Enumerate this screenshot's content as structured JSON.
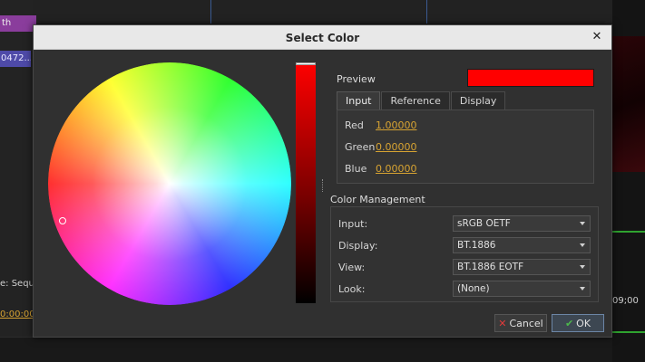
{
  "dialog": {
    "title": "Select Color",
    "close_icon": "close-icon"
  },
  "preview": {
    "label": "Preview",
    "color": "#ff0000"
  },
  "tabs": [
    {
      "label": "Input",
      "active": true
    },
    {
      "label": "Reference",
      "active": false
    },
    {
      "label": "Display",
      "active": false
    }
  ],
  "channels": [
    {
      "label": "Red",
      "value": "1.00000"
    },
    {
      "label": "Green",
      "value": "0.00000"
    },
    {
      "label": "Blue",
      "value": "0.00000"
    }
  ],
  "color_management": {
    "title": "Color Management",
    "rows": [
      {
        "label": "Input:",
        "value": "sRGB OETF"
      },
      {
        "label": "Display:",
        "value": "BT.1886"
      },
      {
        "label": "View:",
        "value": "BT.1886 EOTF"
      },
      {
        "label": "Look:",
        "value": "(None)"
      }
    ]
  },
  "buttons": {
    "cancel": "Cancel",
    "ok": "OK"
  },
  "background": {
    "tag_label": "th",
    "clip_label": "0472....",
    "sequence_label": "e: Seque",
    "timecode_left": "0:00:00;0",
    "timecode_right": "09;00"
  },
  "colors": {
    "accent_link": "#d7a332",
    "selected_color": "#ff0000",
    "timeline_green": "#2fa32f"
  }
}
